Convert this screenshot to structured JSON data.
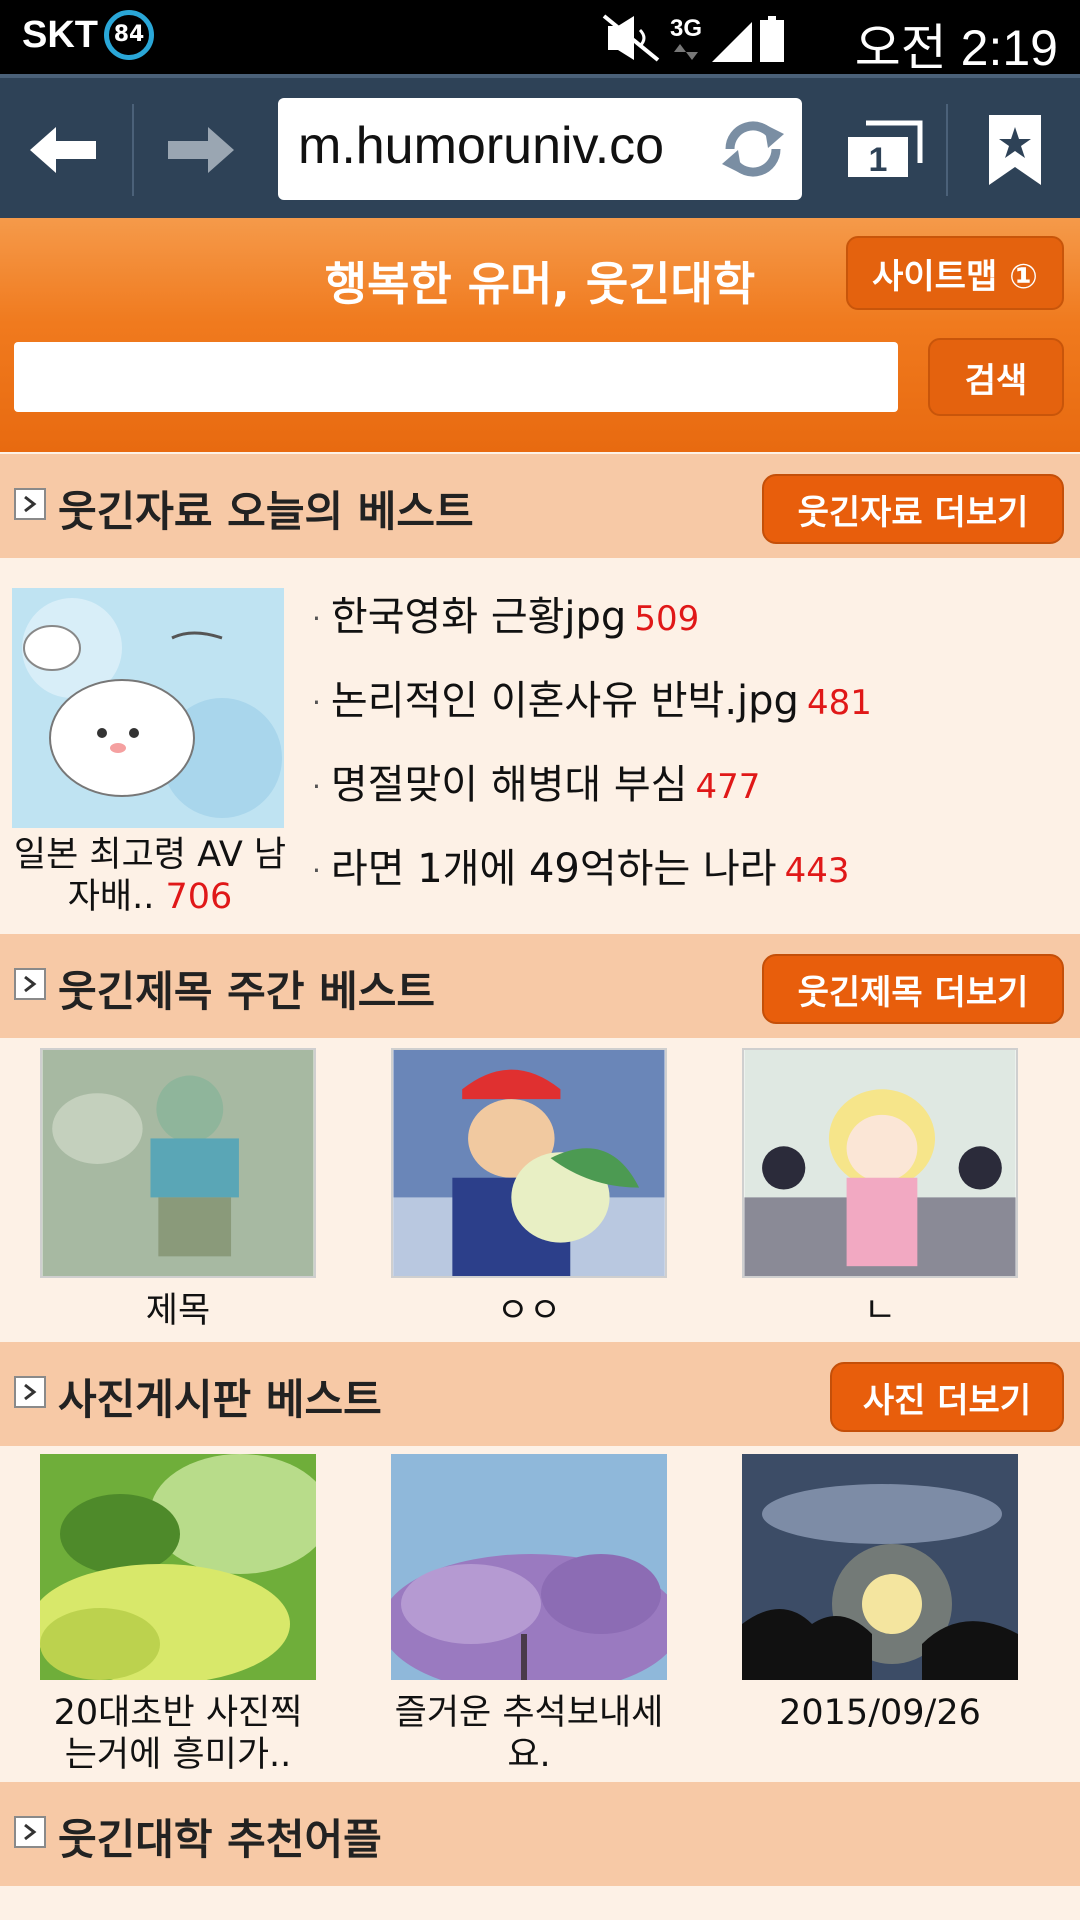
{
  "status_bar": {
    "carrier": "SKT",
    "battery_level": "84",
    "network": "3G",
    "time": "오전 2:19"
  },
  "browser": {
    "url": "m.humoruniv.co",
    "tab_count": "1"
  },
  "site": {
    "title": "행복한 유머, 웃긴대학",
    "sitemap_label": "사이트맵 ①",
    "search_value": "",
    "search_button": "검색"
  },
  "section_today": {
    "title": "웃긴자료 오늘의 베스트",
    "more_label": "웃긴자료 더보기",
    "feature": {
      "caption": "일본 최고령 AV 남자배..",
      "count": "706"
    },
    "list": [
      {
        "title": "한국영화 근황jpg",
        "count": "509"
      },
      {
        "title": "논리적인 이혼사유 반박.jpg",
        "count": "481"
      },
      {
        "title": "명절맞이 해병대 부심",
        "count": "477"
      },
      {
        "title": "라면 1개에 49억하는 나라",
        "count": "443"
      }
    ]
  },
  "section_weekly": {
    "title": "웃긴제목 주간 베스트",
    "more_label": "웃긴제목 더보기",
    "items": [
      {
        "caption": "제목"
      },
      {
        "caption": "ㅇㅇ"
      },
      {
        "caption": "ㄴ"
      }
    ]
  },
  "section_photo": {
    "title": "사진게시판 베스트",
    "more_label": "사진 더보기",
    "items": [
      {
        "caption": "20대초반 사진찍는거에 흥미가.."
      },
      {
        "caption": "즐거운 추석보내세요."
      },
      {
        "caption": "2015/09/26"
      }
    ]
  },
  "section_apps": {
    "title": "웃긴대학 추천어플"
  },
  "colors": {
    "accent": "#f07a1e",
    "button": "#e85e0c",
    "section_bg": "#f7c9a6",
    "count_red": "#e01818",
    "browser_bar": "#2e4257"
  }
}
